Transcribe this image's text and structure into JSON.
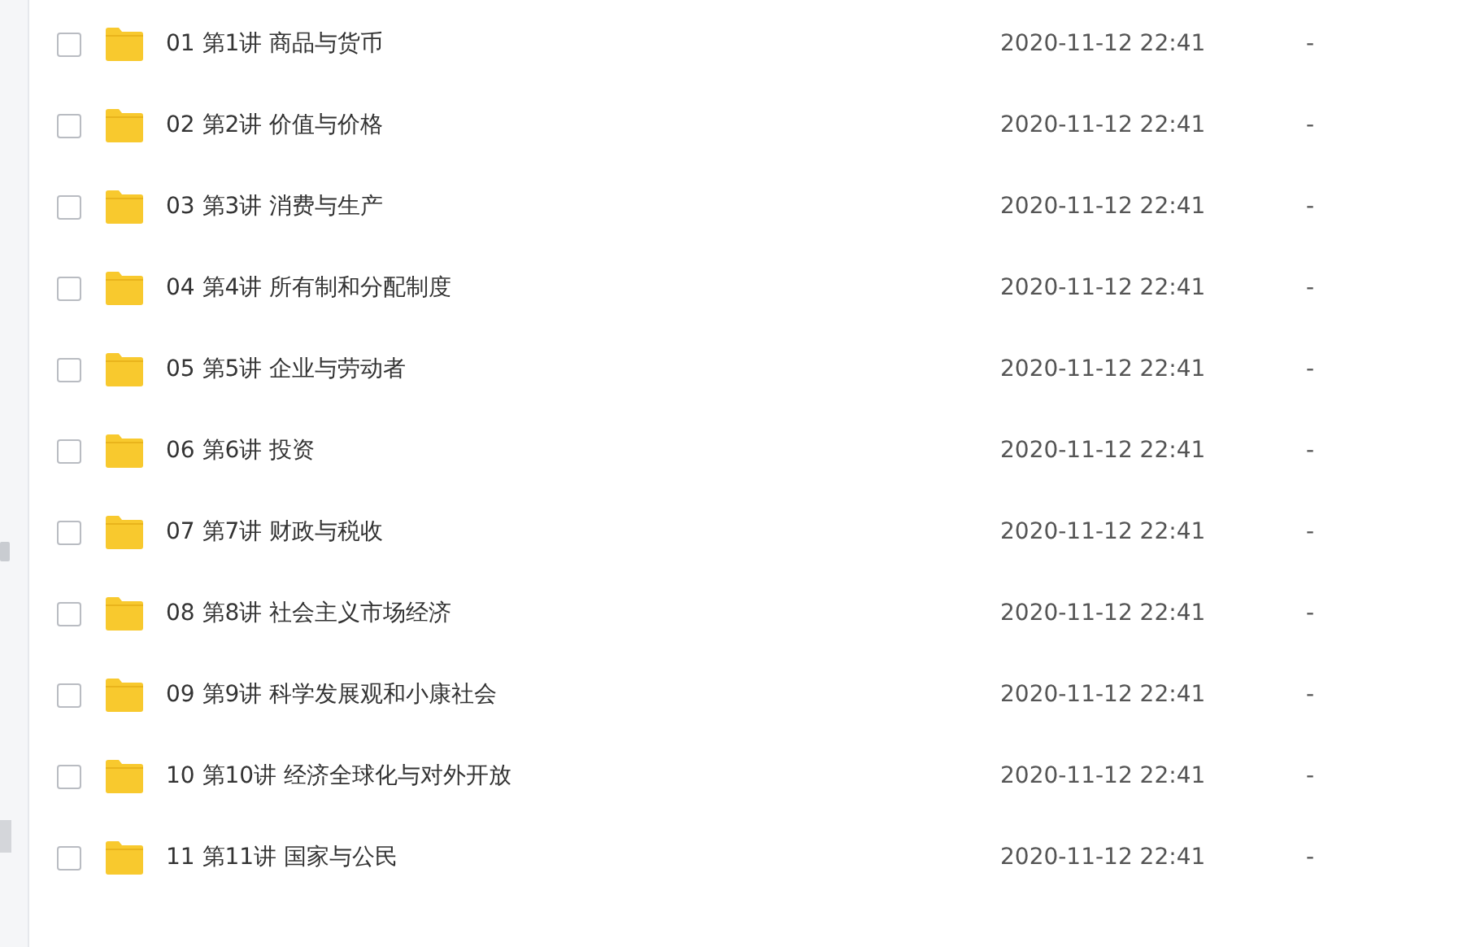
{
  "files": [
    {
      "name": "01 第1讲 商品与货币",
      "modified": "2020-11-12 22:41",
      "size": "-",
      "checked": false
    },
    {
      "name": "02 第2讲 价值与价格",
      "modified": "2020-11-12 22:41",
      "size": "-",
      "checked": false
    },
    {
      "name": "03 第3讲 消费与生产",
      "modified": "2020-11-12 22:41",
      "size": "-",
      "checked": false
    },
    {
      "name": "04 第4讲 所有制和分配制度",
      "modified": "2020-11-12 22:41",
      "size": "-",
      "checked": false
    },
    {
      "name": "05 第5讲 企业与劳动者",
      "modified": "2020-11-12 22:41",
      "size": "-",
      "checked": false
    },
    {
      "name": "06 第6讲 投资",
      "modified": "2020-11-12 22:41",
      "size": "-",
      "checked": false
    },
    {
      "name": "07 第7讲 财政与税收",
      "modified": "2020-11-12 22:41",
      "size": "-",
      "checked": false
    },
    {
      "name": "08 第8讲 社会主义市场经济",
      "modified": "2020-11-12 22:41",
      "size": "-",
      "checked": false
    },
    {
      "name": "09 第9讲 科学发展观和小康社会",
      "modified": "2020-11-12 22:41",
      "size": "-",
      "checked": false
    },
    {
      "name": "10 第10讲 经济全球化与对外开放",
      "modified": "2020-11-12 22:41",
      "size": "-",
      "checked": false
    },
    {
      "name": "11 第11讲 国家与公民",
      "modified": "2020-11-12 22:41",
      "size": "-",
      "checked": false
    }
  ]
}
